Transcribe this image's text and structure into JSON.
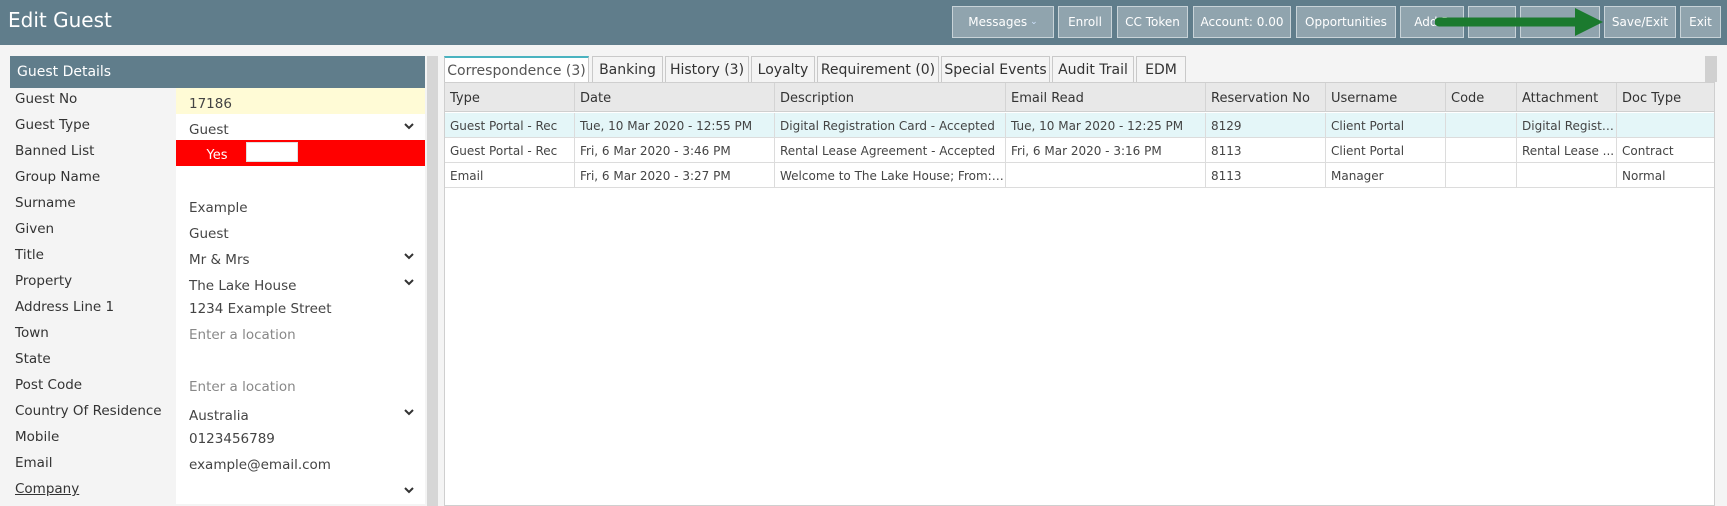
{
  "header": {
    "title": "Edit Guest",
    "buttons": {
      "messages": "Messages",
      "enroll": "Enroll",
      "cc_token": "CC Token",
      "account": "Account: 0.00",
      "opportunities": "Opportunities",
      "add": "Add R",
      "blank1": "",
      "blank2": "",
      "save_exit": "Save/Exit",
      "exit": "Exit"
    },
    "highlight_arrow_color": "#1b7a2e"
  },
  "guest_details": {
    "title": "Guest Details",
    "fields": [
      {
        "label": "Guest No",
        "value": "17186"
      },
      {
        "label": "Guest Type",
        "value": "Guest"
      },
      {
        "label": "Banned List",
        "value": "Yes"
      },
      {
        "label": "Group Name",
        "value": ""
      },
      {
        "label": "Surname",
        "value": "Example"
      },
      {
        "label": "Given",
        "value": "Guest"
      },
      {
        "label": "Title",
        "value": "Mr & Mrs"
      },
      {
        "label": "Property",
        "value": "The Lake House"
      },
      {
        "label": "Address Line 1",
        "value": "1234 Example Street"
      },
      {
        "label": "Town",
        "value": "",
        "placeholder": "Enter a location"
      },
      {
        "label": "State",
        "value": ""
      },
      {
        "label": "Post Code",
        "value": "",
        "placeholder": "Enter a location"
      },
      {
        "label": "Country Of Residence",
        "value": "Australia"
      },
      {
        "label": "Mobile",
        "value": "0123456789"
      },
      {
        "label": "Email",
        "value": "example@email.com"
      },
      {
        "label": "Company",
        "value": ""
      }
    ]
  },
  "tabs": [
    "Correspondence (3)",
    "Banking",
    "History (3)",
    "Loyalty",
    "Requirement (0)",
    "Special Events",
    "Audit Trail",
    "EDM"
  ],
  "grid": {
    "columns": [
      "Type",
      "Date",
      "Description",
      "Email Read",
      "Reservation No",
      "Username",
      "Code",
      "Attachment",
      "Doc Type"
    ],
    "rows": [
      [
        "Guest Portal - Rec",
        "Tue, 10 Mar 2020 - 12:55 PM",
        "Digital Registration Card - Accepted",
        "Tue, 10 Mar 2020 - 12:25 PM",
        "8129",
        "Client Portal",
        "",
        "Digital Registr...",
        ""
      ],
      [
        "Guest Portal - Rec",
        "Fri, 6 Mar 2020 - 3:46 PM",
        "Rental Lease Agreement - Accepted",
        "Fri, 6 Mar 2020 - 3:16 PM",
        "8113",
        "Client Portal",
        "",
        "Rental Lease ...",
        "Contract"
      ],
      [
        "Email",
        "Fri, 6 Mar 2020 - 3:27 PM",
        "Welcome to The Lake House; From: e...",
        "",
        "8113",
        "Manager",
        "",
        "",
        "Normal"
      ]
    ]
  },
  "colors": {
    "header_bg": "#607d8b",
    "button_bg": "#90a4ae",
    "banned_red": "#ff0000",
    "guest_no_bg": "#fffbd6",
    "selected_row": "#e4f6f8",
    "active_tab_accent": "#4ab3c0"
  }
}
